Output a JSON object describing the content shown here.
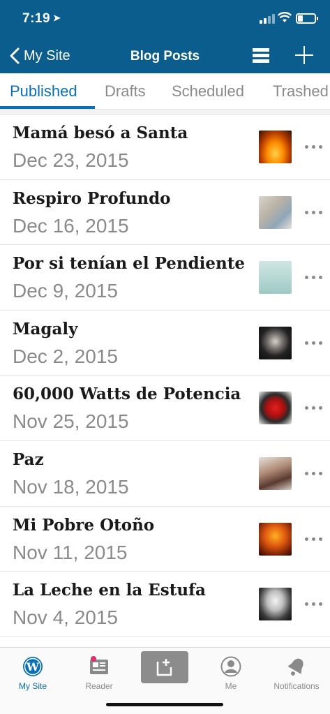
{
  "status_bar": {
    "time": "7:19"
  },
  "nav": {
    "back_label": "My Site",
    "title": "Blog Posts"
  },
  "tabs": [
    "Published",
    "Drafts",
    "Scheduled",
    "Trashed"
  ],
  "active_tab": "Published",
  "posts": [
    {
      "title": "Mamá besó a Santa",
      "date": "Dec 23, 2015"
    },
    {
      "title": "Respiro Profundo",
      "date": "Dec 16, 2015"
    },
    {
      "title": "Por si tenían el Pendiente",
      "date": "Dec 9, 2015"
    },
    {
      "title": "Magaly",
      "date": "Dec 2, 2015"
    },
    {
      "title": "60,000 Watts de Potencia",
      "date": "Nov 25, 2015"
    },
    {
      "title": "Paz",
      "date": "Nov 18, 2015"
    },
    {
      "title": "Mi Pobre Otoño",
      "date": "Nov 11, 2015"
    },
    {
      "title": "La Leche en la Estufa",
      "date": "Nov 4, 2015"
    }
  ],
  "tabbar": {
    "my_site": "My Site",
    "reader": "Reader",
    "me": "Me",
    "notifications": "Notifications"
  },
  "colors": {
    "header": "#0a5d8c",
    "accent": "#0a6fb4",
    "muted": "#8a8a8a",
    "badge": "#d6336c"
  },
  "icons": [
    "location-arrow-icon",
    "signal-icon",
    "wifi-icon",
    "battery-icon",
    "chevron-left-icon",
    "menu-icon",
    "plus-icon",
    "ellipsis-icon",
    "wordpress-icon",
    "reader-icon",
    "new-post-icon",
    "me-icon",
    "bell-icon"
  ]
}
